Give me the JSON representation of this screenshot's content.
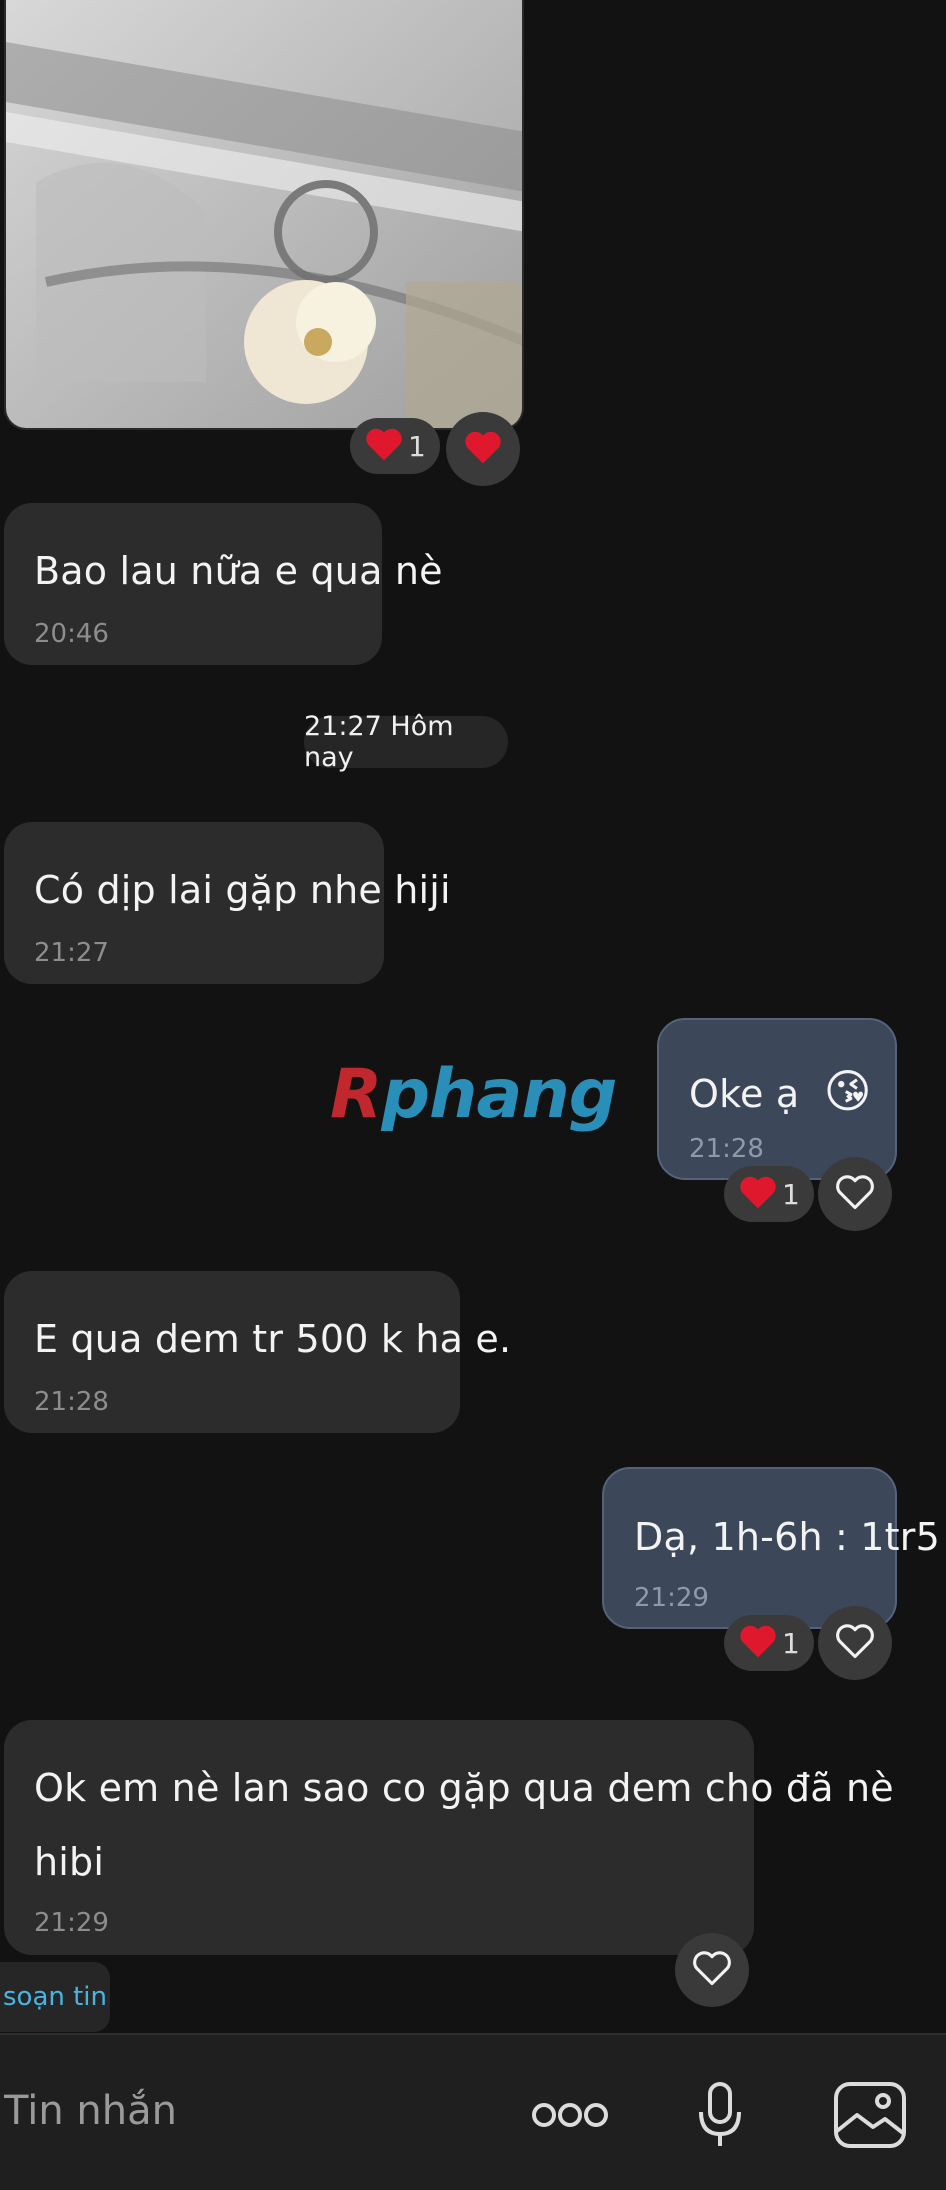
{
  "messages": [
    {
      "text": "Bao lau nữa e qua nè",
      "time": "20:46"
    },
    {
      "text": "Có dịp lai gặp nhe hiji",
      "time": "21:27"
    },
    {
      "text": "Oke ạ",
      "emoji": "😘",
      "time": "21:28"
    },
    {
      "text": "E qua dem tr 500 k ha e.",
      "time": "21:28"
    },
    {
      "text": "Dạ, 1h-6h : 1tr5",
      "time": "21:29"
    },
    {
      "text_line1": "Ok em nè   lan sao co gặp qua dem cho đã nè",
      "text_line2": "hibi",
      "time": "21:29"
    }
  ],
  "date_separator": "21:27 Hôm nay",
  "reaction_count": "1",
  "watermark": {
    "r": "R",
    "rest": "phang"
  },
  "compose_hint": "soạn tin",
  "composer": {
    "placeholder": "Tin nhắn"
  },
  "icons": [
    "heart-icon",
    "heart-outline-icon",
    "more-icon",
    "microphone-icon",
    "image-icon"
  ],
  "colors": {
    "incoming_bubble": "#2c2c2c",
    "outgoing_bubble": "#3c4859",
    "heart": "#e0182d",
    "accent": "#4ab3e0"
  }
}
